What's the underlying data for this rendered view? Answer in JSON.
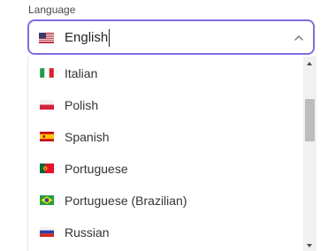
{
  "field": {
    "label": "Language",
    "value": "English",
    "value_flag_icon": "us-flag-icon"
  },
  "options": [
    {
      "label": "Italian",
      "icon": "italy-flag-icon"
    },
    {
      "label": "Polish",
      "icon": "poland-flag-icon"
    },
    {
      "label": "Spanish",
      "icon": "spain-flag-icon"
    },
    {
      "label": "Portuguese",
      "icon": "portugal-flag-icon"
    },
    {
      "label": "Portuguese (Brazilian)",
      "icon": "brazil-flag-icon"
    },
    {
      "label": "Russian",
      "icon": "russia-flag-icon"
    }
  ],
  "colors": {
    "focus_border": "#7b6fe0",
    "text": "#333333"
  }
}
